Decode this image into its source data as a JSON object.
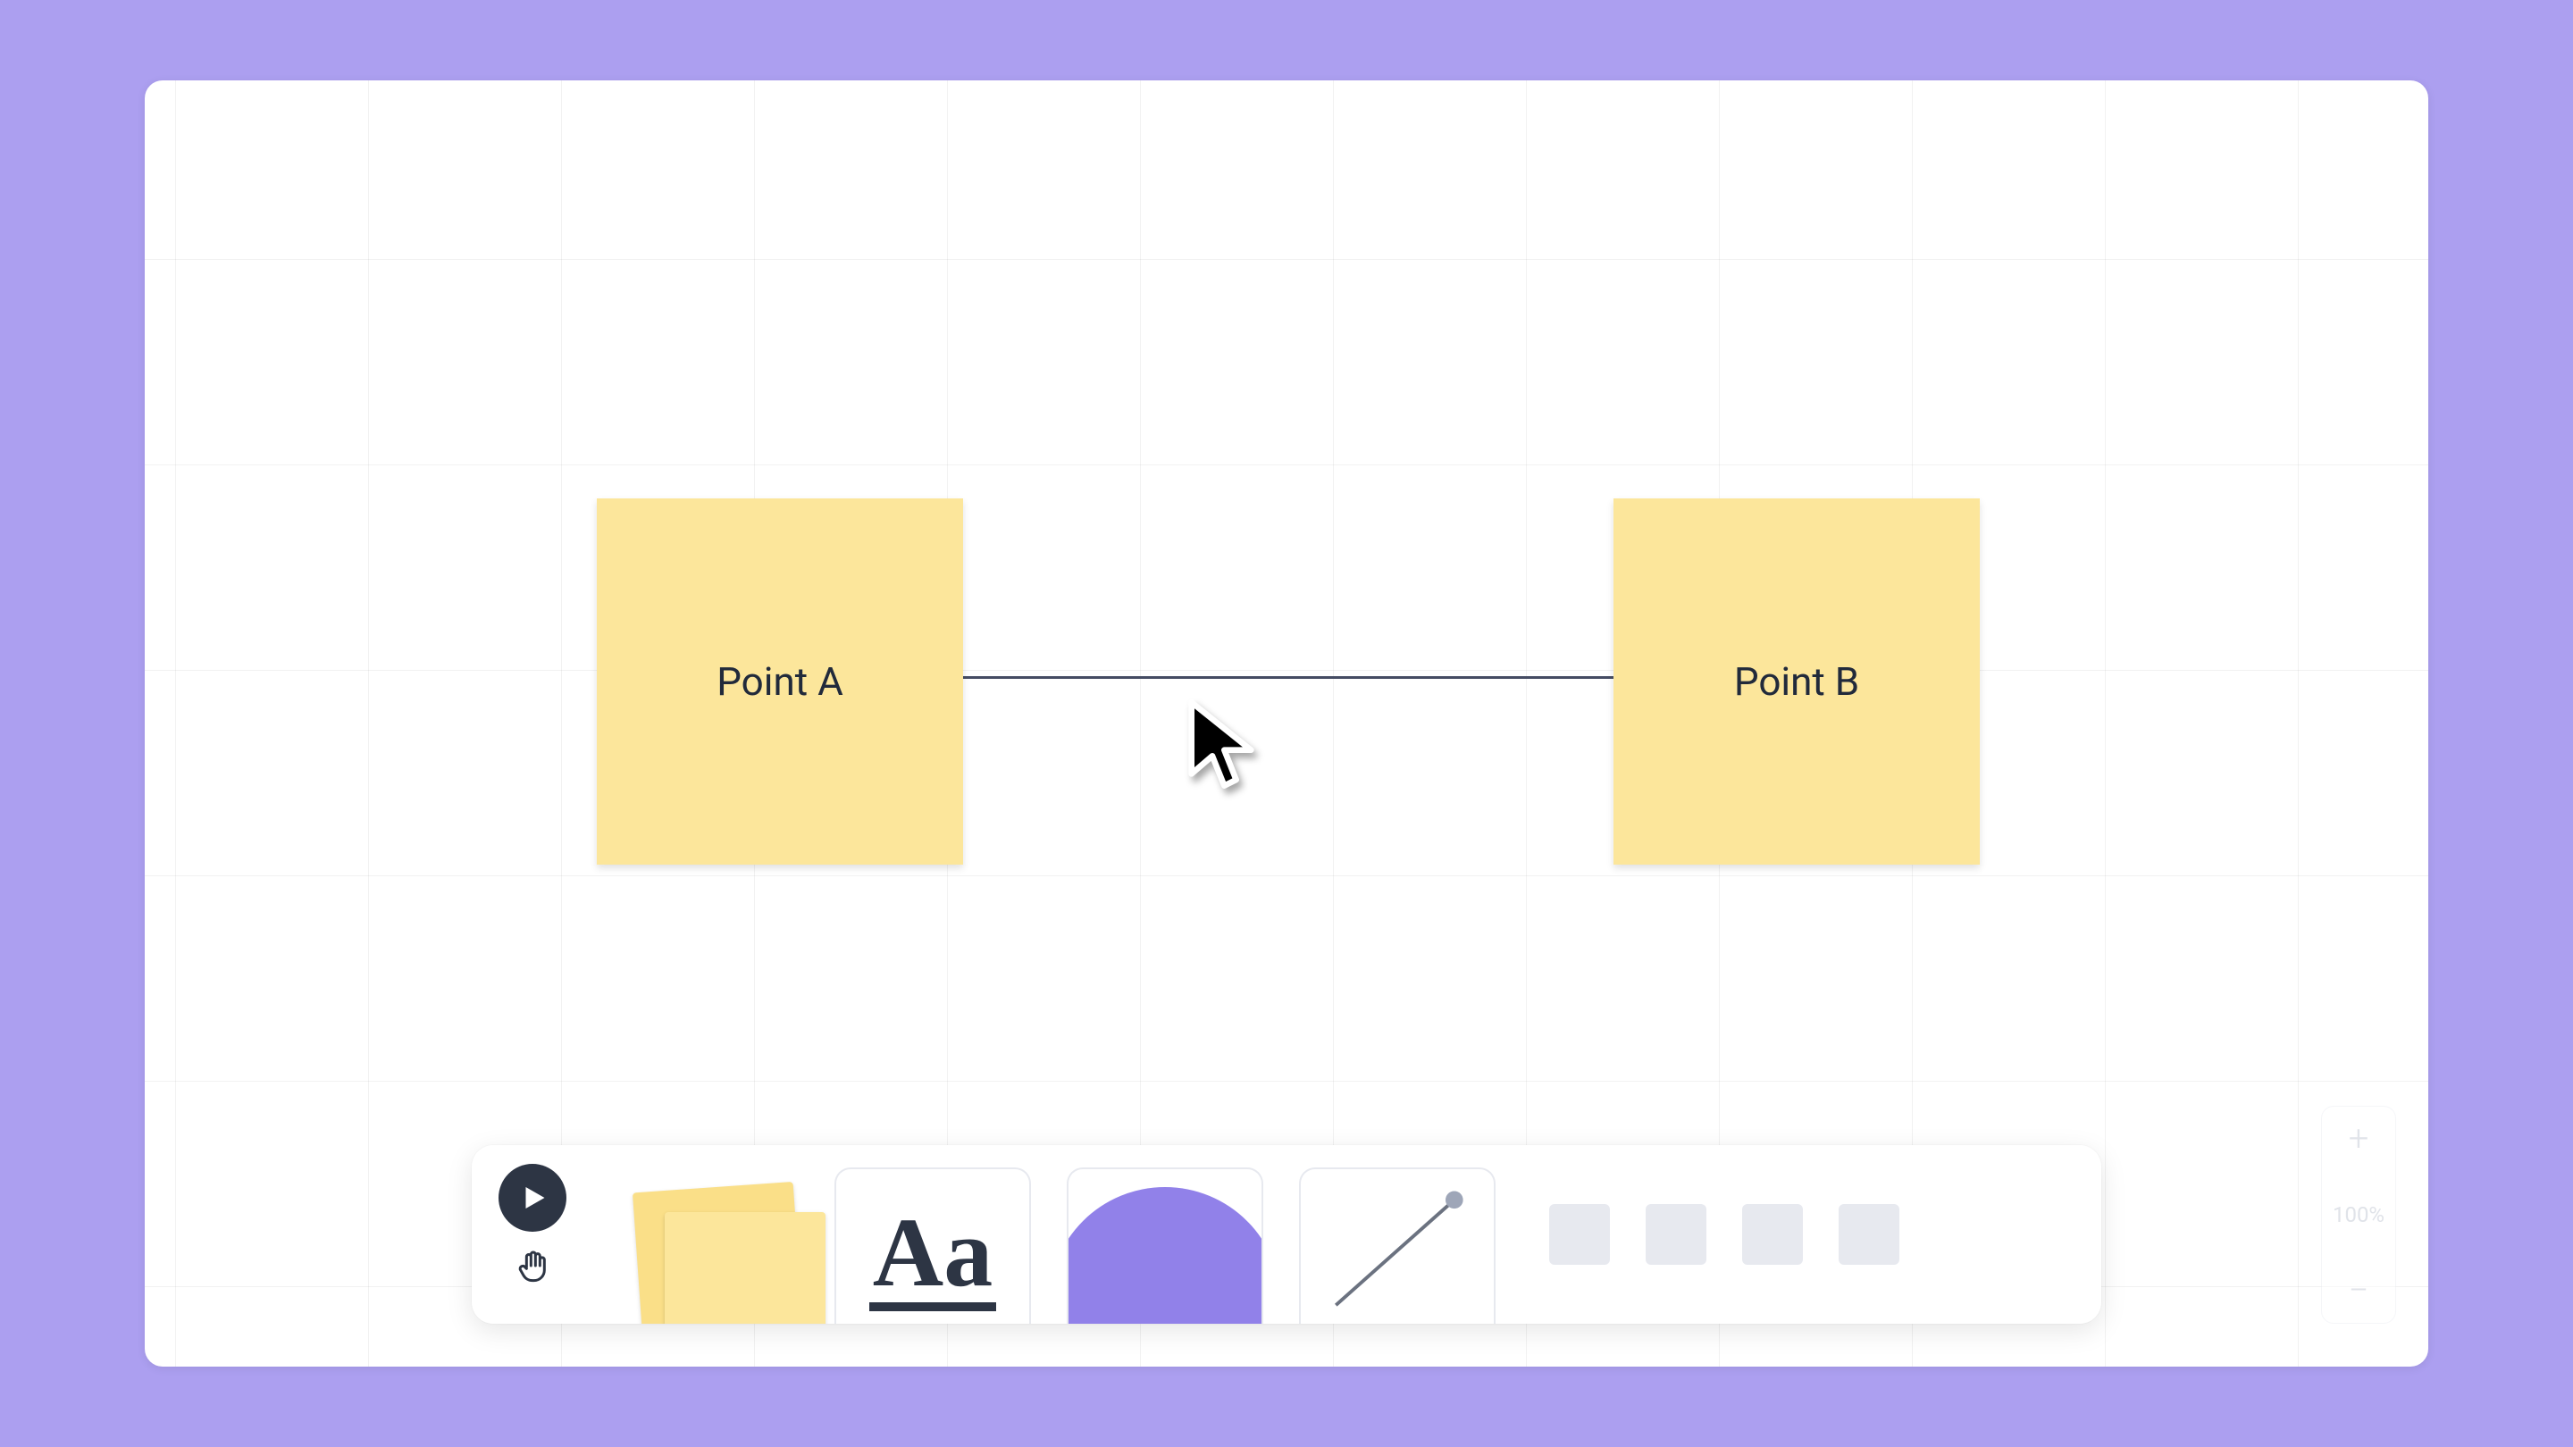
{
  "colors": {
    "page_bg": "#ac9ff0",
    "canvas_bg": "#ffffff",
    "sticky": "#fce69b",
    "accent": "#9181e9",
    "ink": "#2d3544"
  },
  "canvas": {
    "nodes": [
      {
        "id": "a",
        "label": "Point A"
      },
      {
        "id": "b",
        "label": "Point B"
      }
    ],
    "connector": {
      "from": "a",
      "to": "b"
    }
  },
  "toolbar": {
    "text_glyph": "Aa",
    "tools": [
      "select",
      "hand",
      "sticky",
      "text",
      "shape",
      "connector"
    ]
  },
  "zoom": {
    "plus": "+",
    "minus": "−",
    "level": "100%"
  }
}
